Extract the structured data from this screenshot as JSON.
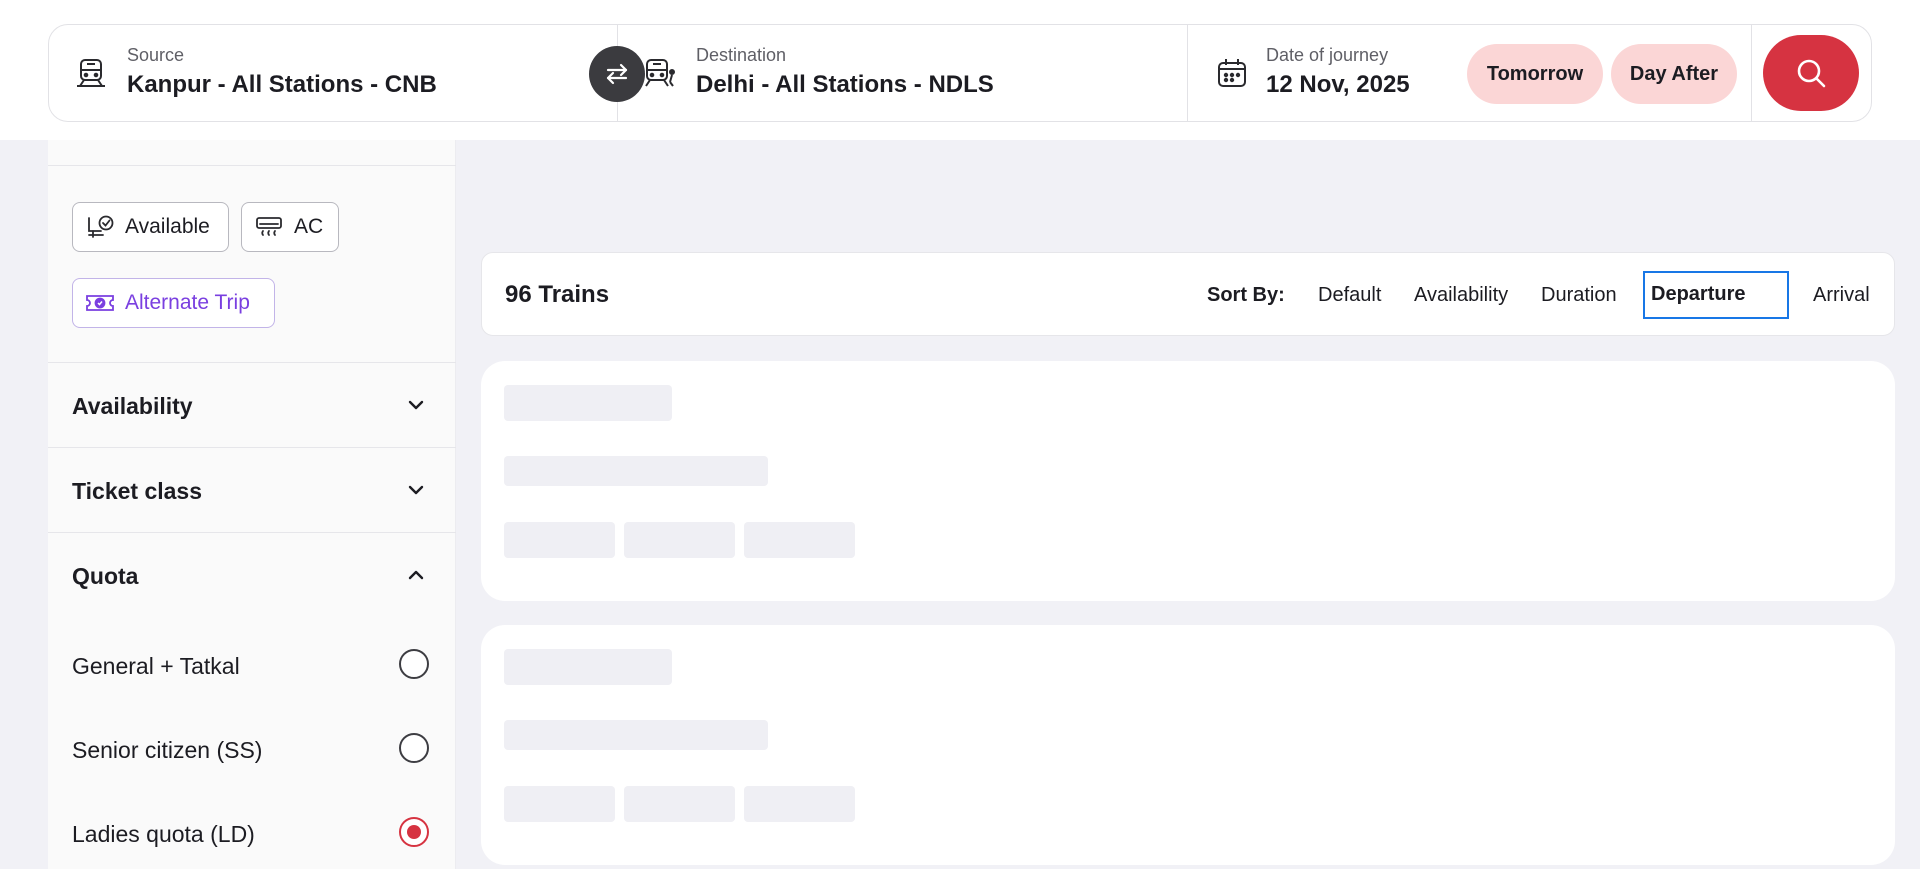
{
  "search": {
    "source": {
      "label": "Source",
      "value": "Kanpur - All Stations - CNB",
      "icon": "train-icon"
    },
    "destination": {
      "label": "Destination",
      "value": "Delhi - All Stations - NDLS",
      "icon": "train-arrive-icon"
    },
    "date": {
      "label": "Date of journey",
      "value": "12 Nov, 2025",
      "icon": "calendar-icon"
    },
    "quick_dates": [
      "Tomorrow",
      "Day After"
    ],
    "swap_icon": "swap-arrows-icon",
    "search_icon": "search-icon"
  },
  "filters": {
    "quick": [
      {
        "label": "Available",
        "icon": "seat-check-icon"
      },
      {
        "label": "AC",
        "icon": "ac-icon"
      },
      {
        "label": "Alternate Trip",
        "icon": "ticket-icon"
      }
    ],
    "sections": {
      "availability": "Availability",
      "ticket_class": "Ticket class",
      "quota": "Quota"
    },
    "quota_options": [
      {
        "label": "General + Tatkal",
        "selected": false
      },
      {
        "label": "Senior citizen (SS)",
        "selected": false
      },
      {
        "label": "Ladies quota (LD)",
        "selected": true
      }
    ]
  },
  "results": {
    "count_label": "96 Trains",
    "sort_label": "Sort By:",
    "sort_options": [
      "Default",
      "Availability",
      "Duration",
      "Departure",
      "Arrival"
    ],
    "active_sort": "Departure"
  },
  "colors": {
    "brand_red": "#d63341",
    "chip_pink": "#fbd6d6",
    "focus_blue": "#1877e6",
    "alt_purple": "#7a3fe0"
  }
}
